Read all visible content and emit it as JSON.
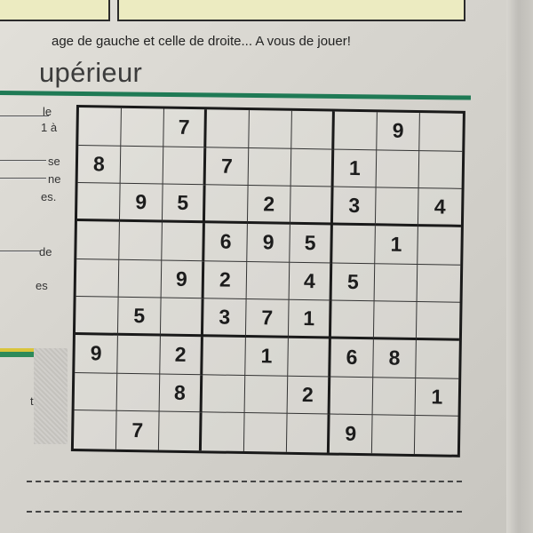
{
  "instruction_fragment": "age de gauche et celle de droite... A vous de jouer!",
  "heading_fragment": "upérieur",
  "left_fragments": [
    "le",
    "1 à",
    "se",
    "ne",
    "es.",
    "de",
    "es",
    "tapez"
  ],
  "colors": {
    "green_rule": "#1f7a55",
    "panel_fill": "#ecebc1",
    "ink": "#1c1c1c"
  },
  "sudoku": {
    "rows": [
      [
        "",
        "",
        "7",
        "",
        "",
        "",
        "",
        "9",
        ""
      ],
      [
        "8",
        "",
        "",
        "7",
        "",
        "",
        "1",
        "",
        ""
      ],
      [
        "",
        "9",
        "5",
        "",
        "2",
        "",
        "3",
        "",
        "4"
      ],
      [
        "",
        "",
        "",
        "6",
        "9",
        "5",
        "",
        "1",
        ""
      ],
      [
        "",
        "",
        "9",
        "2",
        "",
        "4",
        "5",
        "",
        ""
      ],
      [
        "",
        "5",
        "",
        "3",
        "7",
        "1",
        "",
        "",
        ""
      ],
      [
        "9",
        "",
        "2",
        "",
        "1",
        "",
        "6",
        "8",
        ""
      ],
      [
        "",
        "",
        "8",
        "",
        "",
        "2",
        "",
        "",
        "1"
      ],
      [
        "",
        "7",
        "",
        "",
        "",
        "",
        "9",
        "",
        ""
      ]
    ]
  }
}
